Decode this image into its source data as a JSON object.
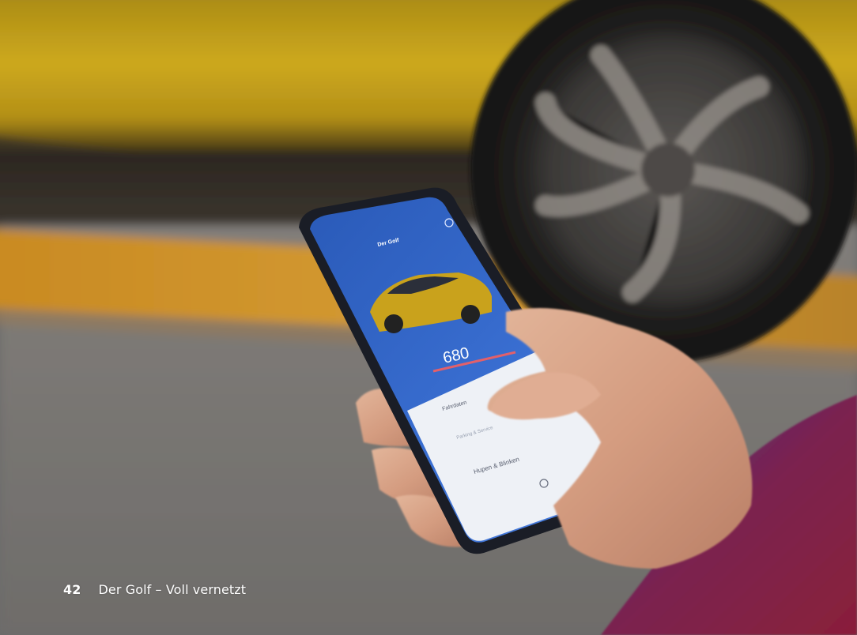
{
  "caption": {
    "page_number": "42",
    "title": "Der Golf – Voll vernetzt"
  },
  "phone_screen": {
    "header": "Der Golf",
    "range_value": "680",
    "menu_items": [
      "Fahrdaten",
      "Parking & Service",
      "Hupen & Blinken"
    ]
  },
  "colors": {
    "car_yellow": "#c9a21c",
    "app_blue": "#2f63c4",
    "parking_orange": "#c98a22",
    "range_underline": "#e2606a",
    "jacket": "#4a2a8a"
  }
}
